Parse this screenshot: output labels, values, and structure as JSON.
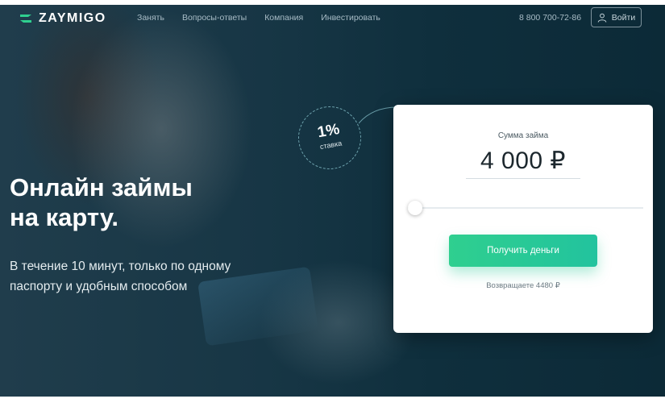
{
  "brand": {
    "name": "ZAYMIGO"
  },
  "nav": {
    "items": [
      "Занять",
      "Вопросы-ответы",
      "Компания",
      "Инвестировать"
    ]
  },
  "header": {
    "phone": "8 800 700-72-86",
    "login_label": "Войти"
  },
  "hero": {
    "title_line1": "Онлайн займы",
    "title_line2": "на карту.",
    "subtitle_line1": "В течение 10 минут, только по одному",
    "subtitle_line2": "паспорту и удобным способом"
  },
  "rate_badge": {
    "value": "1%",
    "label": "ставка"
  },
  "loan_form": {
    "amount_label": "Сумма займа",
    "amount_value": "4 000 ₽",
    "slider_level": 0.0,
    "submit_label": "Получить деньги",
    "repay_text": "Возвращаете 4480 ₽"
  },
  "colors": {
    "accent": "#2fcf8f",
    "background": "#0f2d3b",
    "card": "#ffffff"
  },
  "icons": {
    "logo": "zaymigo-logo-icon",
    "login": "user-icon"
  }
}
